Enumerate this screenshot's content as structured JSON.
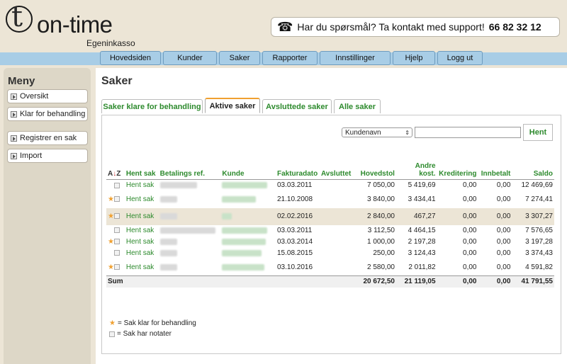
{
  "brand": {
    "logo_letter": "t",
    "name": "on-time",
    "sub": "Egeninkasso"
  },
  "support": {
    "text": "Har du spørsmål? Ta kontakt med support!",
    "phone": "66 82 32 12"
  },
  "nav": [
    "Hovedsiden",
    "Kunder",
    "Saker",
    "Rapporter",
    "Innstillinger",
    "Hjelp",
    "Logg ut"
  ],
  "sidebar": {
    "title": "Meny",
    "items": [
      "Oversikt",
      "Klar for behandling",
      "Registrer en sak",
      "Import"
    ]
  },
  "page": {
    "title": "Saker"
  },
  "tabs": [
    "Saker klare for behandling",
    "Aktive saker",
    "Avsluttede saker",
    "Alle saker"
  ],
  "filter": {
    "select_value": "Kundenavn",
    "button": "Hent"
  },
  "table": {
    "headers": [
      "Hent sak",
      "Betalings ref.",
      "Kunde",
      "Fakturadato",
      "Avsluttet",
      "Hovedstol",
      "Andre kost.",
      "Kreditering",
      "Innbetalt",
      "Saldo"
    ],
    "rows": [
      {
        "star": false,
        "link": "Hent sak",
        "date": "03.03.2011",
        "hovedstol": "7 050,00",
        "andre": "5 419,69",
        "kred": "0,00",
        "innb": "0,00",
        "saldo": "12 469,69"
      },
      {
        "star": true,
        "link": "Hent sak",
        "date": "21.10.2008",
        "hovedstol": "3 840,00",
        "andre": "3 434,41",
        "kred": "0,00",
        "innb": "0,00",
        "saldo": "7 274,41"
      },
      {
        "star": true,
        "link": "Hent sak",
        "date": "02.02.2016",
        "hovedstol": "2 840,00",
        "andre": "467,27",
        "kred": "0,00",
        "innb": "0,00",
        "saldo": "3 307,27"
      },
      {
        "star": false,
        "link": "Hent sak",
        "date": "03.03.2011",
        "hovedstol": "3 112,50",
        "andre": "4 464,15",
        "kred": "0,00",
        "innb": "0,00",
        "saldo": "7 576,65"
      },
      {
        "star": true,
        "link": "Hent sak",
        "date": "03.03.2014",
        "hovedstol": "1 000,00",
        "andre": "2 197,28",
        "kred": "0,00",
        "innb": "0,00",
        "saldo": "3 197,28"
      },
      {
        "star": false,
        "link": "Hent sak",
        "date": "15.08.2015",
        "hovedstol": "250,00",
        "andre": "3 124,43",
        "kred": "0,00",
        "innb": "0,00",
        "saldo": "3 374,43"
      },
      {
        "star": true,
        "link": "Hent sak",
        "date": "03.10.2016",
        "hovedstol": "2 580,00",
        "andre": "2 011,82",
        "kred": "0,00",
        "innb": "0,00",
        "saldo": "4 591,82"
      }
    ],
    "sum": {
      "label": "Sum",
      "hovedstol": "20 672,50",
      "andre": "21 119,05",
      "kred": "0,00",
      "innb": "0,00",
      "saldo": "41 791,55"
    }
  },
  "legend": {
    "star": "= Sak klar for behandling",
    "note": "= Sak har notater"
  },
  "colors": {
    "accent_green": "#2d8a2d",
    "nav_blue": "#a8cde6",
    "beige": "#ece5d6",
    "tab_orange": "#f0a030"
  }
}
